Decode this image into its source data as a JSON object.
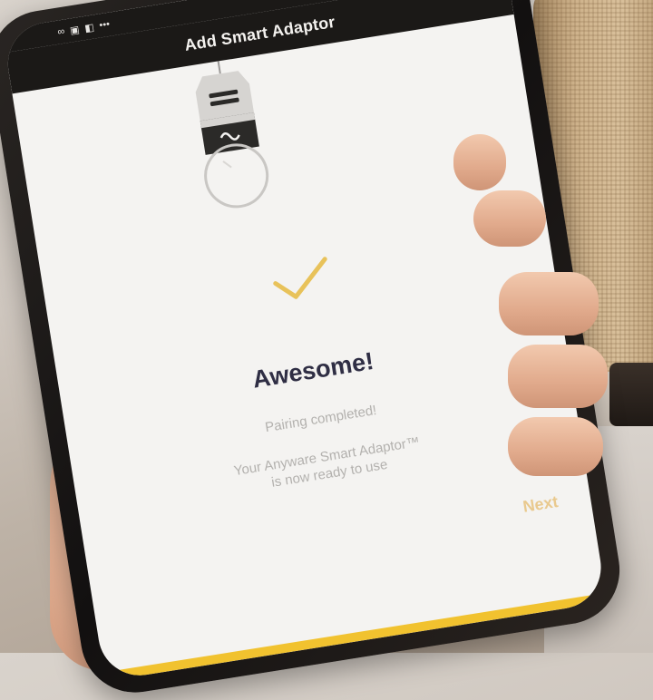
{
  "status_bar": {
    "icons": [
      "link-icon",
      "gallery-icon",
      "message-icon",
      "more-icon"
    ]
  },
  "app_bar": {
    "title": "Add Smart Adaptor"
  },
  "result": {
    "headline": "Awesome!",
    "status": "Pairing completed!",
    "detail_line_1": "Your Anyware Smart Adaptor™",
    "detail_line_2": "is now ready to use"
  },
  "actions": {
    "next_label": "Next"
  },
  "colors": {
    "accent": "#f1c22f",
    "check": "#e8c25a",
    "next_text": "#e9c98e",
    "headline": "#2f2e44",
    "app_bar": "#1b1917"
  }
}
